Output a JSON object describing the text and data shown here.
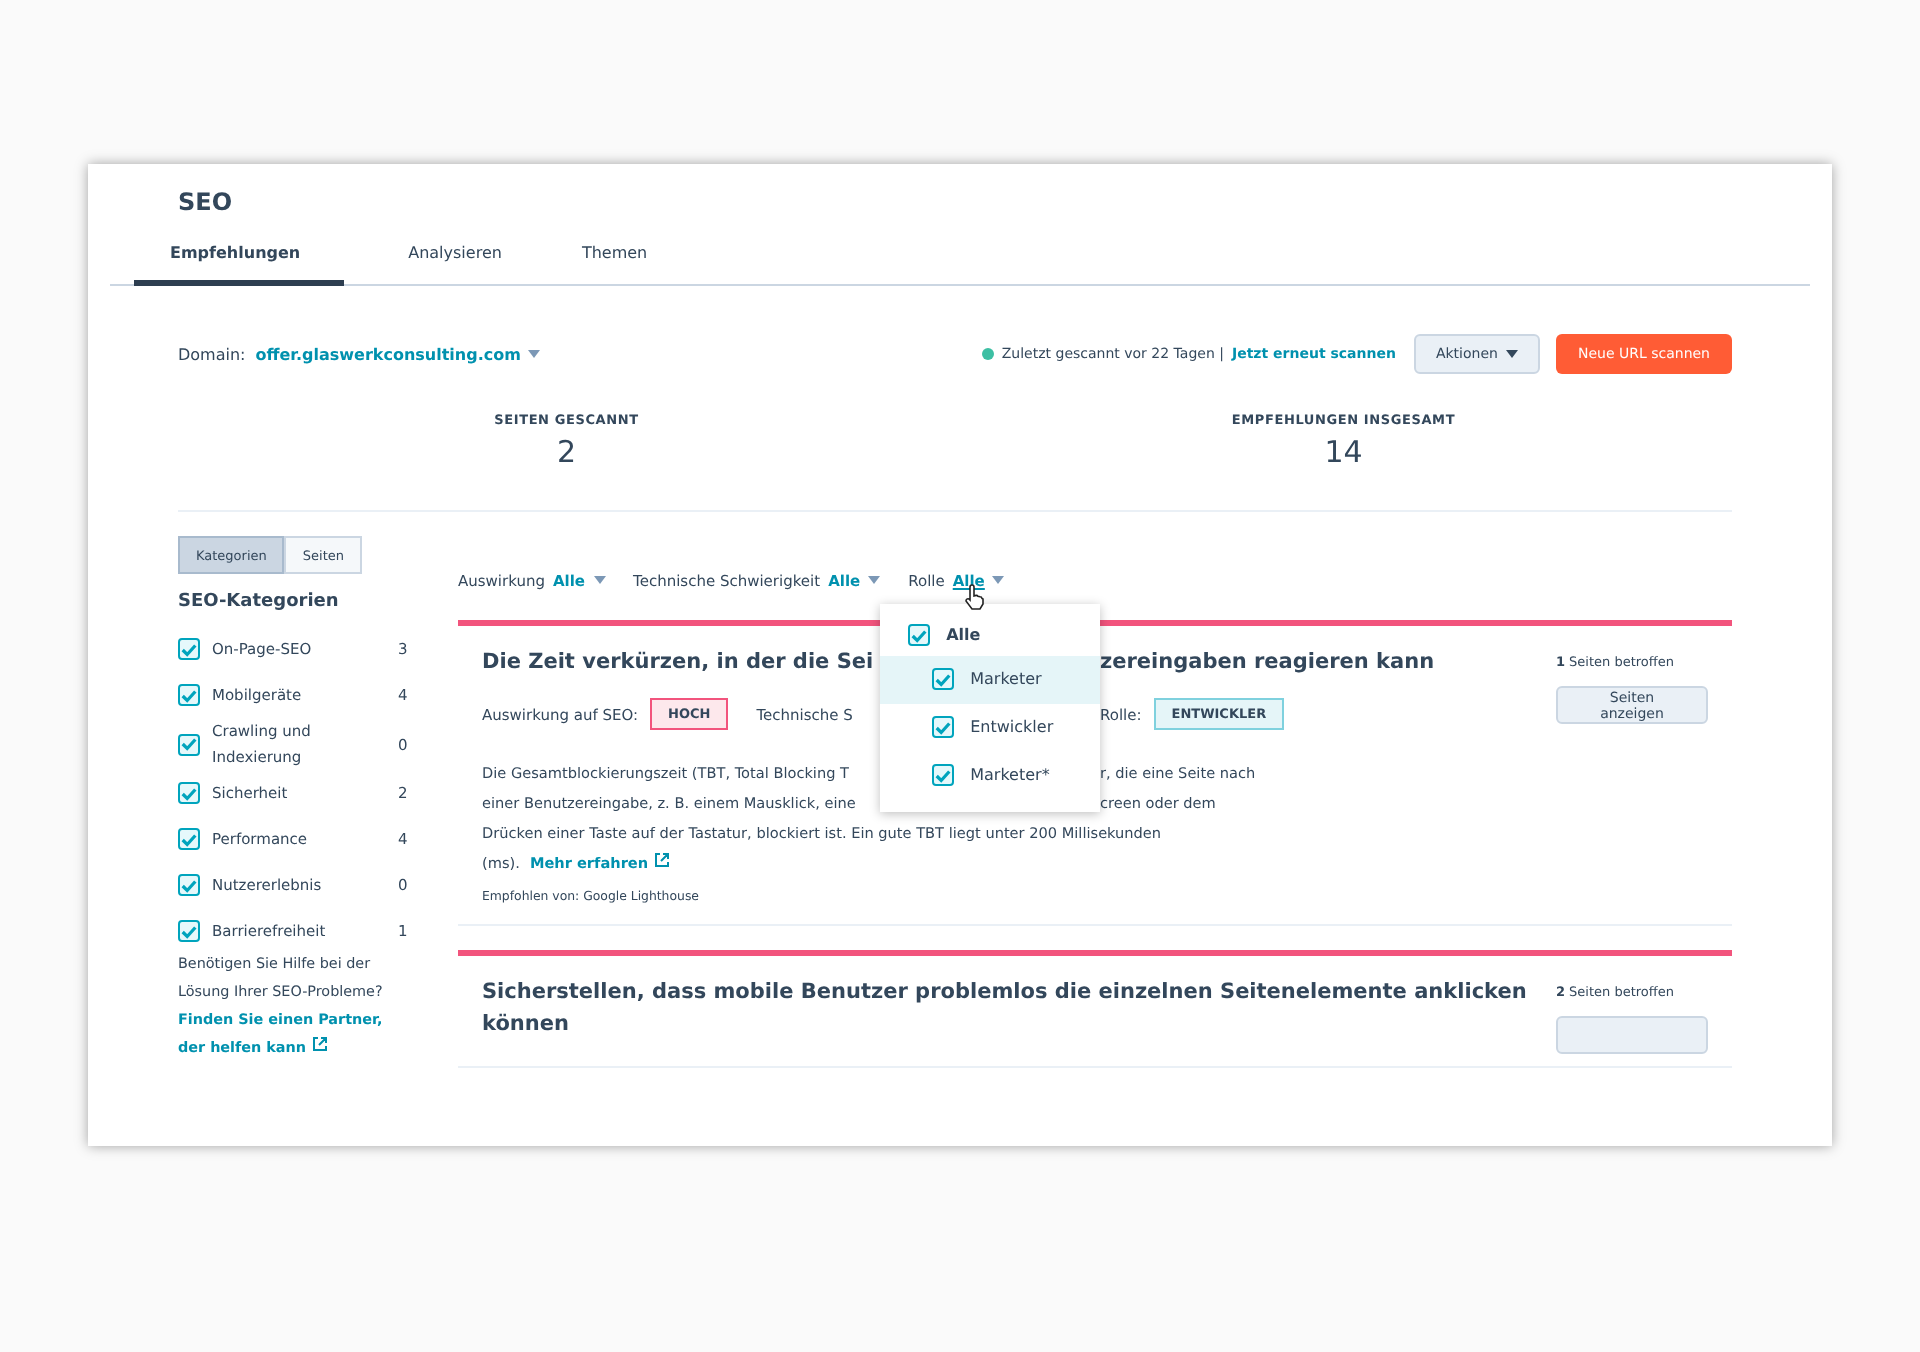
{
  "page_title": "SEO",
  "tabs": [
    {
      "label": "Empfehlungen",
      "selected": true
    },
    {
      "label": "Analysieren",
      "selected": false
    },
    {
      "label": "Themen",
      "selected": false
    }
  ],
  "domain": {
    "label": "Domain:",
    "value": "offer.glaswerkconsulting.com"
  },
  "scan_status": {
    "text": "Zuletzt gescannt vor 22 Tagen |",
    "link": "Jetzt erneut scannen"
  },
  "actions_button": "Aktionen",
  "primary_button": "Neue URL scannen",
  "stats": [
    {
      "label": "SEITEN GESCANNT",
      "value": "2"
    },
    {
      "label": "EMPFEHLUNGEN INSGESAMT",
      "value": "14"
    }
  ],
  "view_toggle": [
    {
      "label": "Kategorien",
      "selected": true
    },
    {
      "label": "Seiten",
      "selected": false
    }
  ],
  "sidebar": {
    "heading": "SEO-Kategorien",
    "categories": [
      {
        "label": "On-Page-SEO",
        "count": "3",
        "checked": true
      },
      {
        "label": "Mobilgeräte",
        "count": "4",
        "checked": true
      },
      {
        "label": "Crawling und Indexierung",
        "count": "0",
        "checked": true
      },
      {
        "label": "Sicherheit",
        "count": "2",
        "checked": true
      },
      {
        "label": "Performance",
        "count": "4",
        "checked": true
      },
      {
        "label": "Nutzererlebnis",
        "count": "0",
        "checked": true
      },
      {
        "label": "Barrierefreiheit",
        "count": "1",
        "checked": true
      }
    ],
    "help_text": "Benötigen Sie Hilfe bei der Lösung Ihrer SEO-Probleme?",
    "help_link": "Finden Sie einen Partner, der helfen kann"
  },
  "filters": [
    {
      "label": "Auswirkung",
      "value": "Alle",
      "expanded": false
    },
    {
      "label": "Technische Schwierigkeit",
      "value": "Alle",
      "expanded": false
    },
    {
      "label": "Rolle",
      "value": "Alle",
      "expanded": true
    }
  ],
  "role_dropdown": {
    "items": [
      {
        "label": "Alle",
        "checked": true,
        "highlighted": false,
        "kind": "all"
      },
      {
        "label": "Marketer",
        "checked": true,
        "highlighted": true,
        "kind": "option"
      },
      {
        "label": "Entwickler",
        "checked": true,
        "highlighted": false,
        "kind": "option"
      },
      {
        "label": "Marketer*",
        "checked": true,
        "highlighted": false,
        "kind": "option"
      }
    ]
  },
  "recommendations": [
    {
      "title": [
        "Die Zeit verkürzen, in der die Sei",
        "zereingaben reagieren kann"
      ],
      "impact_label": "Auswirkung auf SEO:",
      "impact": "HOCH",
      "difficulty_label": "Technische S",
      "role_label": "Rolle:",
      "role": "ENTWICKLER",
      "description": [
        [
          "Die Gesamtblockierungszeit (TBT, Total Blocking T",
          "r, die eine Seite nach"
        ],
        [
          "einer Benutzereingabe, z. B. einem Mausklick, eine",
          "creen oder dem"
        ],
        [
          "Drücken einer Taste auf der Tastatur, blockiert ist. Ein gute TBT liegt unter 200 Millisekunden"
        ]
      ],
      "description_end": "(ms).",
      "link": "Mehr erfahren",
      "source": "Empfohlen von: Google Lighthouse",
      "pages_count": "1",
      "pages_label": "Seiten betroffen",
      "pages_button": "Seiten anzeigen"
    },
    {
      "title": [
        "Sicherstellen, dass mobile Benutzer problemlos die einzelnen Seitenelemente anklicken können"
      ],
      "pages_count": "2",
      "pages_label": "Seiten betroffen"
    }
  ]
}
